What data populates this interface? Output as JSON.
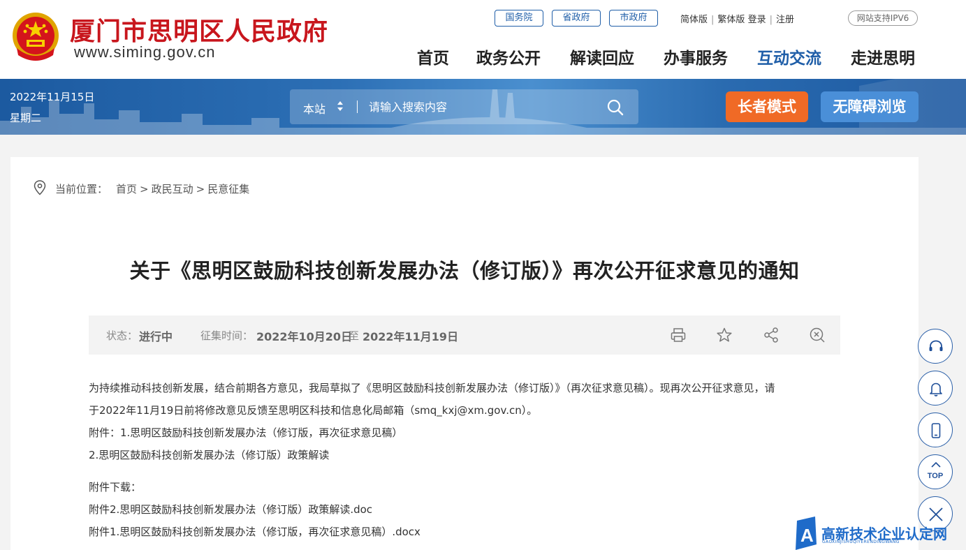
{
  "header": {
    "site_name": "厦门市思明区人民政府",
    "site_url": "www.siming.gov.cn",
    "gov_links": [
      "国务院",
      "省政府",
      "市政府"
    ],
    "top_links": [
      "简体版",
      "繁体版",
      "登录",
      "注册"
    ],
    "ipv6_badge": "网站支持IPV6",
    "nav": [
      "首页",
      "政务公开",
      "解读回应",
      "办事服务",
      "互动交流",
      "走进思明"
    ],
    "active_nav": "互动交流"
  },
  "banner": {
    "date": "2022年11月15日",
    "weekday": "星期二",
    "search_scope": "本站",
    "search_placeholder": "请输入搜索内容",
    "elder_mode": "长者模式",
    "accessible": "无障碍浏览"
  },
  "breadcrumb": {
    "label": "当前位置：",
    "items": [
      "首页",
      "政民互动",
      "民意征集"
    ]
  },
  "article": {
    "title": "关于《思明区鼓励科技创新发展办法（修订版）》再次公开征求意见的通知",
    "status_label": "状态：",
    "status_value": "进行中",
    "period_label": "征集时间：",
    "period_start": "2022年10月20日",
    "period_to": "至",
    "period_end": "2022年11月19日",
    "paragraph_line1": "为持续推动科技创新发展，结合前期各方意见，我局草拟了《思明区鼓励科技创新发展办法（修订版）》（再次征求意见稿）。现再次公开征求意见，请",
    "paragraph_line2": "于2022年11月19日前将修改意见反馈至思明区科技和信息化局邮箱（smq_kxj@xm.gov.cn）。",
    "attach_line1": "附件：1.思明区鼓励科技创新发展办法（修订版，再次征求意见稿）",
    "attach_line2": "2.思明区鼓励科技创新发展办法（修订版）政策解读",
    "download_label": "附件下载：",
    "download_1": "附件2.思明区鼓励科技创新发展办法（修订版）政策解读.doc",
    "download_2": "附件1.思明区鼓励科技创新发展办法（修订版，再次征求意见稿）.docx"
  },
  "float_bar": {
    "top_label": "TOP"
  },
  "watermark": {
    "text": "高新技术企业认定网",
    "sub": "GAOXINJISHUQIYERENDINGWANG"
  },
  "colors": {
    "brand_red": "#c8161d",
    "brand_blue": "#1f5ea8",
    "elder_orange": "#f06a26"
  }
}
